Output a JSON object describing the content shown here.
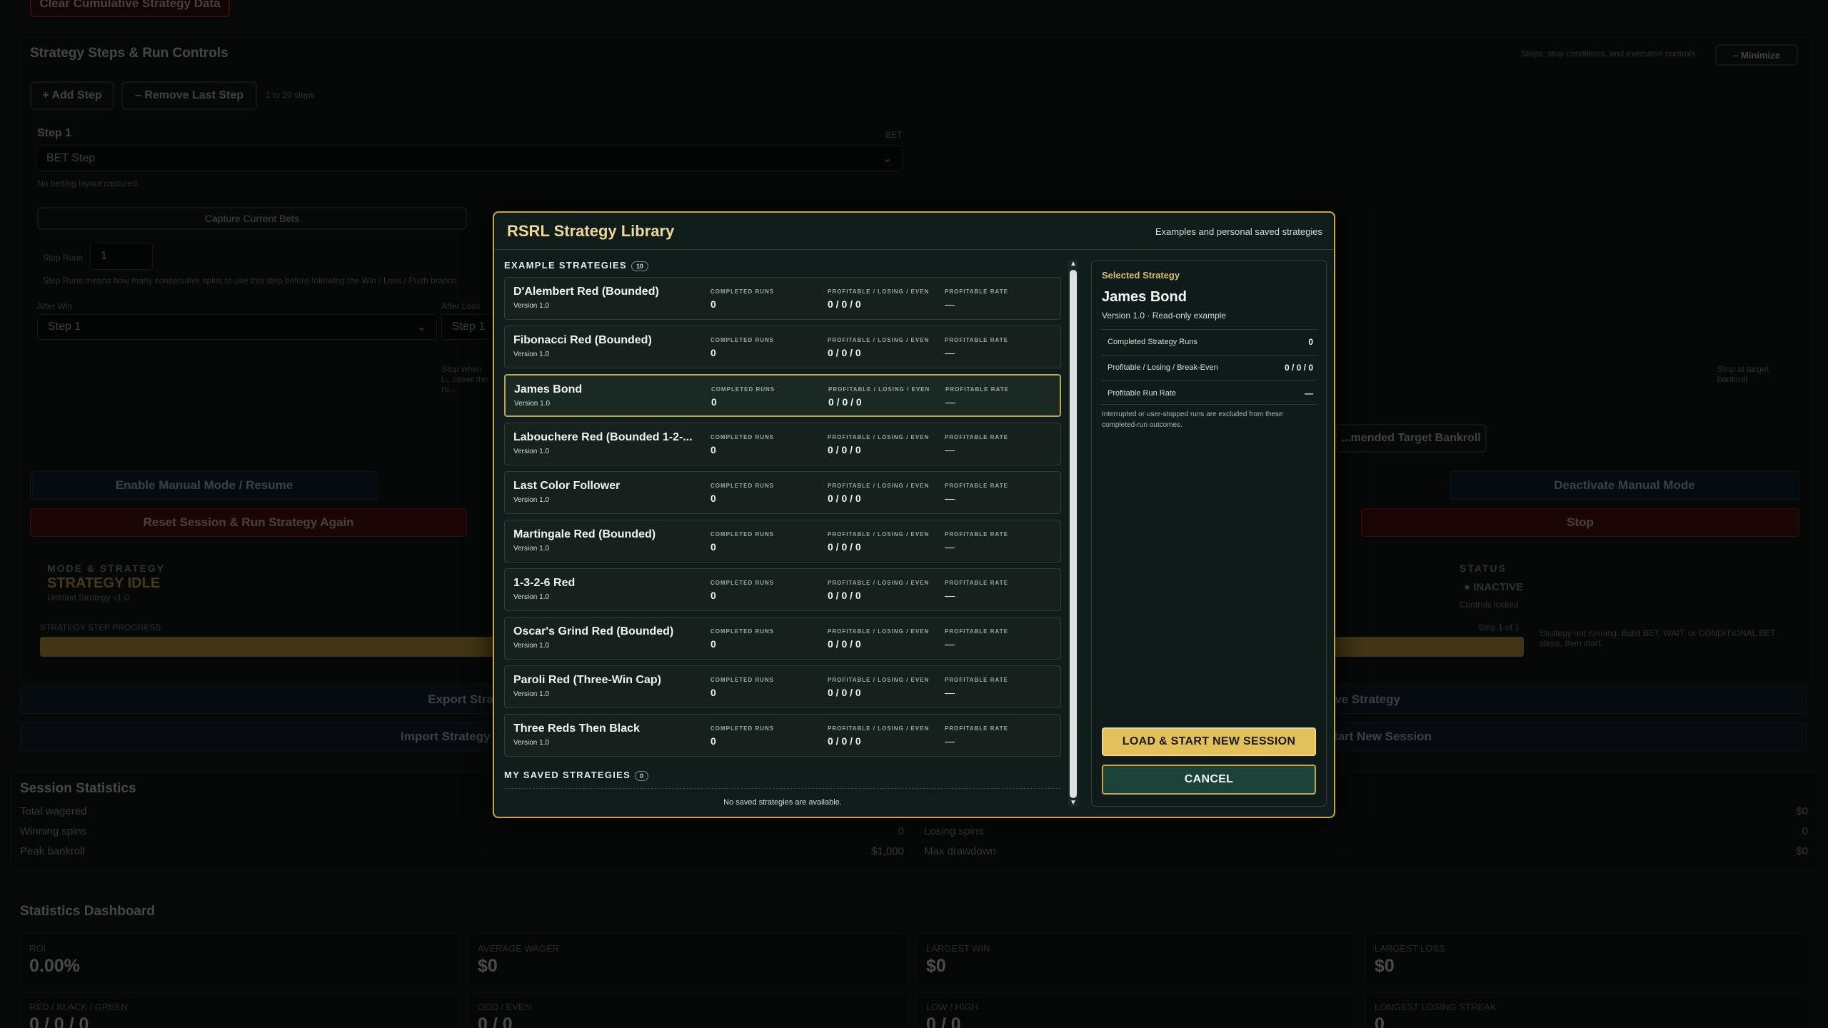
{
  "background": {
    "clear_button": "Clear Cumulative Strategy Data",
    "steps_section": {
      "title": "Strategy Steps & Run Controls",
      "subtitle": "Steps, stop conditions, and execution controls",
      "minimize_button": "– Minimize",
      "add_step_button": "+ Add Step",
      "remove_step_button": "– Remove Last Step",
      "steps_hint": "1 to 20 steps",
      "step_label": "Step 1",
      "step_type_badge": "BET",
      "step_type_select": "BET Step",
      "no_layout_text": "No betting layout captured.",
      "capture_button": "Capture Current Bets",
      "step_runs_label": "Step Runs",
      "step_runs_value": "1",
      "step_runs_hint": "Step Runs means how many consecutive spins to use this step before following the Win / Loss / Push branch.",
      "after_win_label": "After Win",
      "after_win_value": "Step 1",
      "after_loss_label": "After Loss",
      "after_loss_value": "Step 1",
      "stop_when_text": "Stop when i... cover the ru...",
      "stop_target_text": "Stop at target bankroll",
      "recommended_button": "...mended Target Bankroll",
      "enable_manual_button": "Enable Manual Mode / Resume",
      "disable_manual_button": "Deactivate Manual Mode",
      "reset_button": "Reset Session & Run Strategy Again",
      "stop_button": "Stop",
      "mode_label": "MODE & STRATEGY",
      "mode_value": "STRATEGY IDLE",
      "mode_sub": "Untitled Strategy v1.0",
      "status_label": "STATUS",
      "status_value": "● INACTIVE",
      "status_sub": "Controls locked",
      "progress_label": "STRATEGY STEP PROGRESS",
      "progress_step": "Step 1 of 1",
      "progress_fraction": 1.0,
      "status_note": "Strategy not running. Build BET, WAIT, or CONDITIONAL BET steps, then start.",
      "export_button": "Export Strat...",
      "save_button": "...ve Strategy",
      "import_button": "Import Strategy & Sta...",
      "load_new_button": "...y & Start New Session"
    },
    "session_stats": {
      "title": "Session Statistics",
      "rows_left": [
        {
          "label": "Total wagered",
          "value": "$0"
        },
        {
          "label": "Winning spins",
          "value": "0"
        },
        {
          "label": "Peak bankroll",
          "value": "$1,000"
        }
      ],
      "rows_right": [
        {
          "label": "",
          "value": "$0"
        },
        {
          "label": "Losing spins",
          "value": "0"
        },
        {
          "label": "Max drawdown",
          "value": "$0"
        }
      ]
    },
    "dashboard": {
      "title": "Statistics Dashboard",
      "cards": [
        {
          "label": "ROI",
          "value": "0.00%"
        },
        {
          "label": "AVERAGE WAGER",
          "value": "$0"
        },
        {
          "label": "LARGEST WIN",
          "value": "$0"
        },
        {
          "label": "LARGEST LOSS",
          "value": "$0"
        },
        {
          "label": "RED / BLACK / GREEN",
          "value": "0 / 0 / 0"
        },
        {
          "label": "ODD / EVEN",
          "value": "0 / 0"
        },
        {
          "label": "LOW / HIGH",
          "value": "0 / 0"
        },
        {
          "label": "LONGEST LOSING STREAK",
          "value": "0"
        }
      ]
    }
  },
  "modal": {
    "title": "RSRL Strategy Library",
    "subtitle": "Examples and personal saved strategies",
    "examples_title": "EXAMPLE STRATEGIES",
    "examples_count": "10",
    "column_labels": {
      "completed": "COMPLETED RUNS",
      "profit": "PROFITABLE / LOSING / EVEN",
      "rate": "PROFITABLE RATE"
    },
    "strategies": [
      {
        "name": "D'Alembert Red (Bounded)",
        "version": "Version 1.0",
        "completed": "0",
        "profit": "0 / 0 / 0",
        "rate": "—"
      },
      {
        "name": "Fibonacci Red (Bounded)",
        "version": "Version 1.0",
        "completed": "0",
        "profit": "0 / 0 / 0",
        "rate": "—"
      },
      {
        "name": "James Bond",
        "version": "Version 1.0",
        "completed": "0",
        "profit": "0 / 0 / 0",
        "rate": "—"
      },
      {
        "name": "Labouchere Red (Bounded 1-2-...",
        "version": "Version 1.0",
        "completed": "0",
        "profit": "0 / 0 / 0",
        "rate": "—"
      },
      {
        "name": "Last Color Follower",
        "version": "Version 1.0",
        "completed": "0",
        "profit": "0 / 0 / 0",
        "rate": "—"
      },
      {
        "name": "Martingale Red (Bounded)",
        "version": "Version 1.0",
        "completed": "0",
        "profit": "0 / 0 / 0",
        "rate": "—"
      },
      {
        "name": "1-3-2-6 Red",
        "version": "Version 1.0",
        "completed": "0",
        "profit": "0 / 0 / 0",
        "rate": "—"
      },
      {
        "name": "Oscar's Grind Red (Bounded)",
        "version": "Version 1.0",
        "completed": "0",
        "profit": "0 / 0 / 0",
        "rate": "—"
      },
      {
        "name": "Paroli Red (Three-Win Cap)",
        "version": "Version 1.0",
        "completed": "0",
        "profit": "0 / 0 / 0",
        "rate": "—"
      },
      {
        "name": "Three Reds Then Black",
        "version": "Version 1.0",
        "completed": "0",
        "profit": "0 / 0 / 0",
        "rate": "—"
      }
    ],
    "selected_index": 2,
    "saved_title": "MY SAVED STRATEGIES",
    "saved_count": "0",
    "saved_empty": "No saved strategies are available.",
    "side": {
      "label": "Selected Strategy",
      "name": "James Bond",
      "version": "Version 1.0 · Read-only example",
      "rows": [
        {
          "key": "Completed Strategy Runs",
          "value": "0"
        },
        {
          "key": "Profitable / Losing / Break-Even",
          "value": "0 / 0 / 0"
        },
        {
          "key": "Profitable Run Rate",
          "value": "—"
        }
      ],
      "note": "Interrupted or user-stopped runs are excluded from these completed-run outcomes.",
      "load_button": "LOAD & START NEW SESSION",
      "cancel_button": "CANCEL"
    }
  }
}
